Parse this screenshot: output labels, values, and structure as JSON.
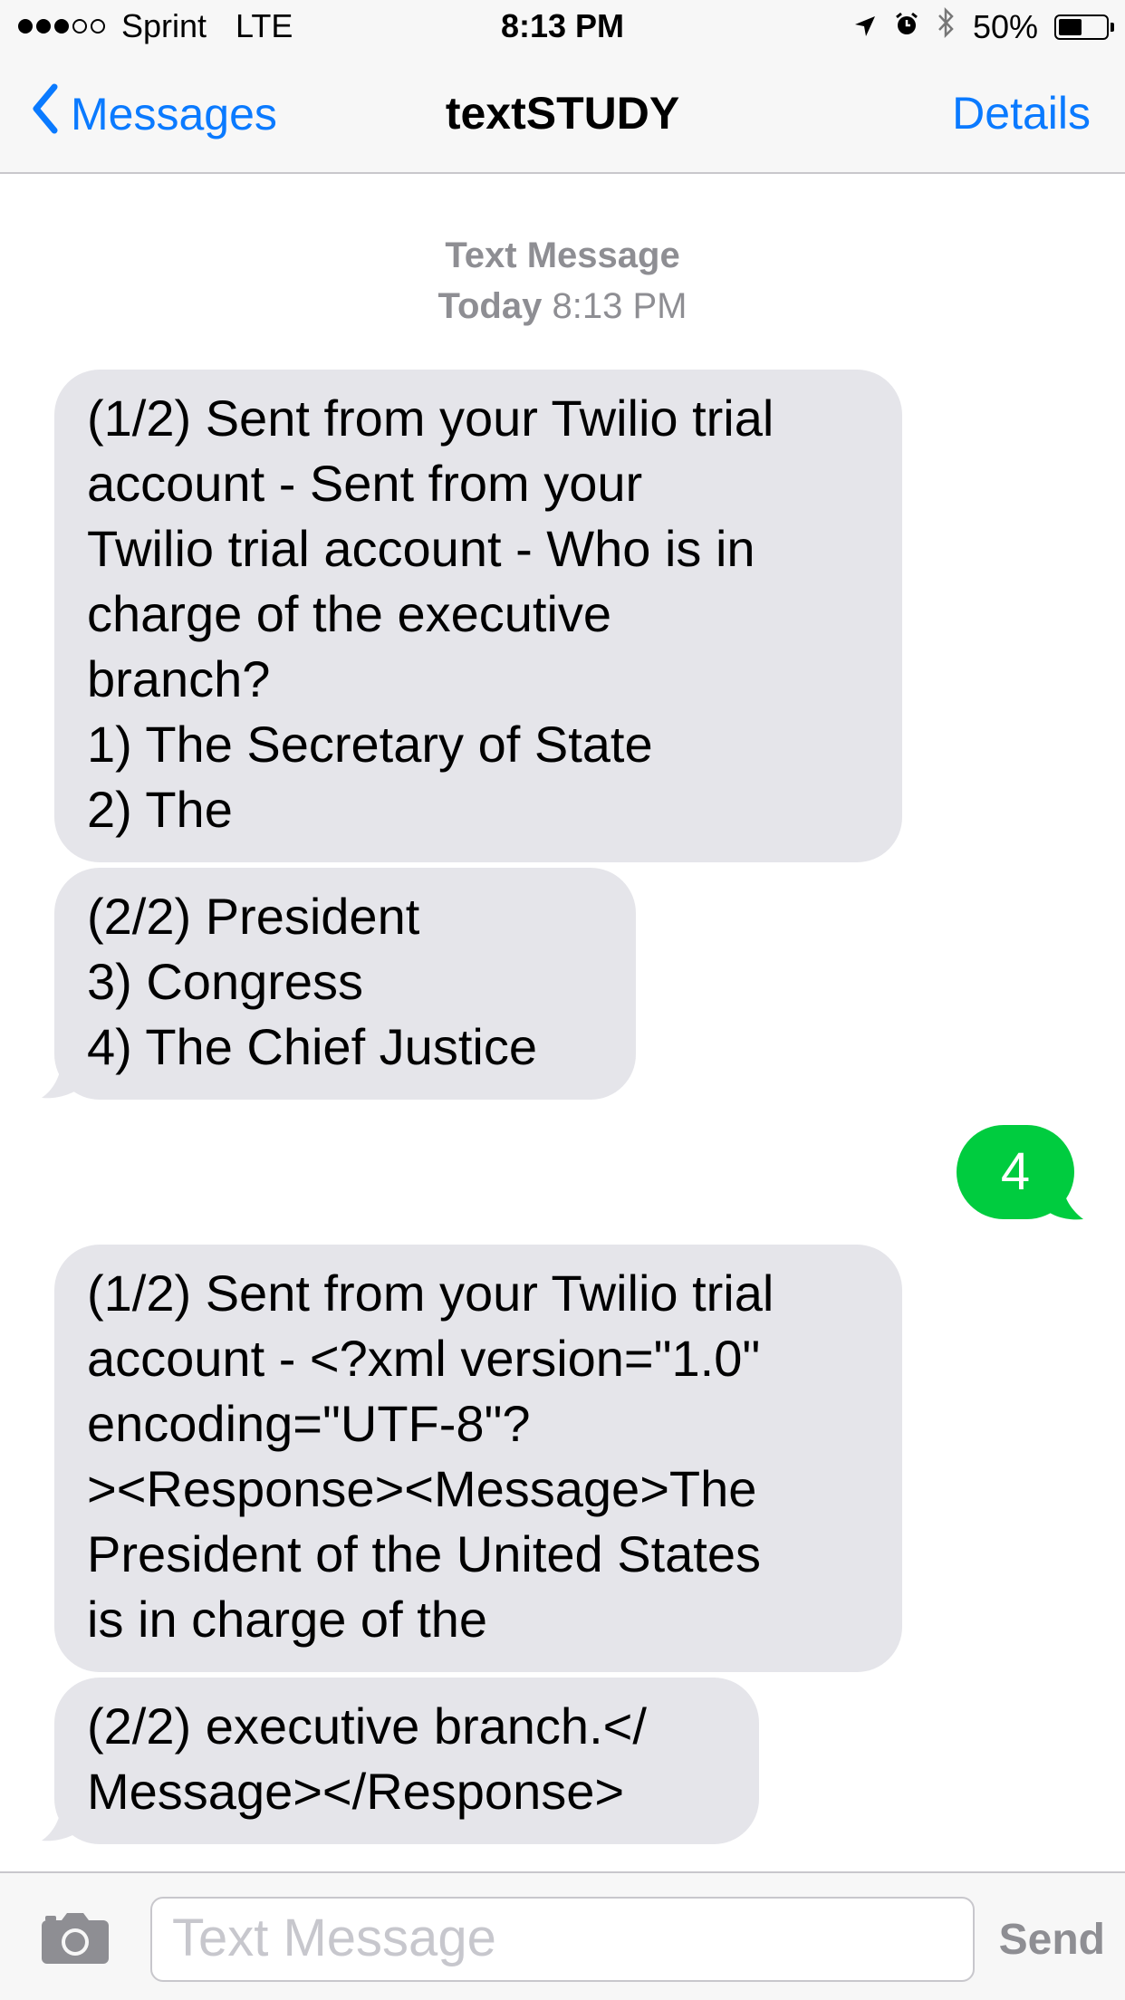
{
  "status_bar": {
    "carrier": "Sprint",
    "network": "LTE",
    "time": "8:13 PM",
    "battery_percent_label": "50%",
    "battery_level": 0.5,
    "signal_bars_filled": 3,
    "signal_bars_total": 5
  },
  "nav": {
    "back_label": "Messages",
    "title": "textSTUDY",
    "details_label": "Details"
  },
  "timestamp": {
    "type_label": "Text Message",
    "day": "Today",
    "time": "8:13 PM"
  },
  "messages": [
    {
      "direction": "received",
      "text": "(1/2) Sent from your Twilio trial\naccount - Sent from your\nTwilio trial account - Who is in\ncharge of the executive\nbranch?\n1) The Secretary of State\n2) The"
    },
    {
      "direction": "received",
      "text": "(2/2) President\n3) Congress\n4) The Chief Justice"
    },
    {
      "direction": "sent",
      "text": "4"
    },
    {
      "direction": "received",
      "text": "(1/2) Sent from your Twilio trial\naccount - <?xml version=\"1.0\"\nencoding=\"UTF-8\"?\n><Response><Message>The\nPresident of the United States\nis in charge of the"
    },
    {
      "direction": "received",
      "text": "(2/2) executive branch.</\nMessage></Response>"
    }
  ],
  "input_bar": {
    "placeholder": "Text Message",
    "send_label": "Send",
    "camera_icon": "camera-icon"
  },
  "colors": {
    "ios_blue": "#0a7aff",
    "sent_bubble": "#00cc3f",
    "received_bubble": "#e5e5ea",
    "gray_text": "#8e8e93"
  }
}
